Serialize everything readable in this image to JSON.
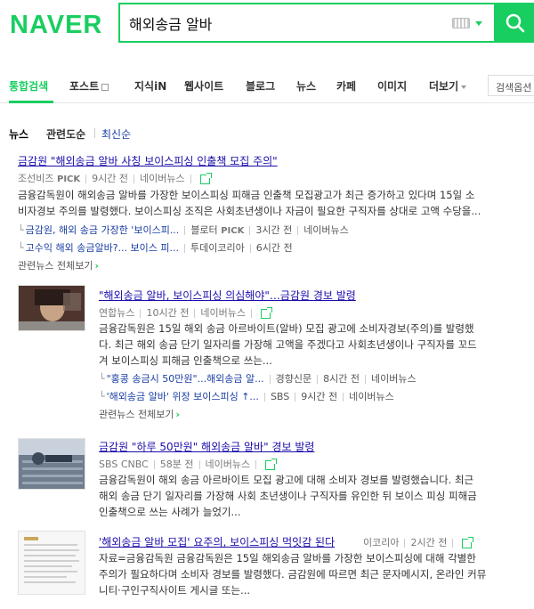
{
  "header": {
    "logo": "NAVER",
    "query": "해외송금 알바"
  },
  "tabs": {
    "items": [
      "통합검색",
      "포스트",
      "지식iN",
      "웹사이트",
      "블로그",
      "뉴스",
      "카페",
      "이미지",
      "더보기"
    ],
    "search_option": "검색옵션"
  },
  "sort": {
    "label": "뉴스",
    "options": [
      "관련도순",
      "최신순"
    ]
  },
  "articles": [
    {
      "title": "금감원 \"해외송금 알바 사칭 보이스피싱 인출책 모집 주의\"",
      "source": "조선비즈",
      "pick": "PICK",
      "time": "9시간 전",
      "naver": "네이버뉴스",
      "desc_line1": "금융감독원이 해외송금 알바를 가장한 보이스피싱 피해금 인출책 모집광고가 최근 증가하고 있다며 15일 소",
      "desc_line2": "비자경보 주의를 발령했다. 보이스피싱 조직은 사회초년생이나 자금이 필요한 구직자를 상대로 고액 수당을...",
      "subs": [
        {
          "text": "금감원, 해외 송금 가장한 '보이스피...",
          "source": "블로터",
          "pick": "PICK",
          "time": "3시간 전",
          "naver": "네이버뉴스"
        },
        {
          "text": "고수익 해외 송금알바?... 보이스 피...",
          "source": "투데이코리아",
          "time": "6시간 전"
        }
      ],
      "related": "관련뉴스 전체보기"
    },
    {
      "title": "\"해외송금 알바, 보이스피싱 의심해야\"…금감원 경보 발령",
      "source": "연합뉴스",
      "time": "10시간 전",
      "naver": "네이버뉴스",
      "desc_line1": "금융감독원은 15일 해외 송금 아르바이트(알바) 모집 광고에 소비자경보(주의)를 발령했",
      "desc_line2": "다. 최근 해외 송금 단기 일자리를 가장해 고액을 주겠다고 사회초년생이나 구직자를 꼬드",
      "desc_line3": "겨 보이스피싱 피해금 인출책으로 쓰는...",
      "subs": [
        {
          "text": "\"홍콩 송금시 50만원\"...해외송금 알...",
          "source": "경향신문",
          "time": "8시간 전",
          "naver": "네이버뉴스"
        },
        {
          "text": "'해외송금 알바' 위장 보이스피싱 ↑...",
          "source": "SBS",
          "time": "9시간 전",
          "naver": "네이버뉴스"
        }
      ],
      "related": "관련뉴스 전체보기"
    },
    {
      "title": "금감원 \"하루 50만원\" 해외송금 알바\" 경보 발령",
      "source": "SBS CNBC",
      "time": "58분 전",
      "naver": "네이버뉴스",
      "desc_line1": "금융감독원이 해외 송금 아르바이트 모집 광고에 대해 소비자 경보를 발령했습니다. 최근",
      "desc_line2": "해외 송금 단기 일자리를 가장해 사회 초년생이나 구직자를 유인한 뒤 보이스 피싱 피해금",
      "desc_line3": "인출책으로 쓰는 사례가 늘었기..."
    },
    {
      "title": "'해외송금 알바 모집' 요주의, 보이스피싱 먹잇감 된다",
      "source": "이코리아",
      "time": "2시간 전",
      "desc_line1": "자료=금융감독원 금융감독원은 15일 해외송금 알바를 가장한 보이스피싱에 대해 각별한",
      "desc_line2": "주의가 필요하다며 소비자 경보를 발령했다. 금감원에 따르면 최근 문자메시지, 온라인 커뮤",
      "desc_line3": "니티·구인구직사이트 게시글 또는..."
    }
  ],
  "colors": {
    "brand": "#19ce60",
    "link": "#1a0dab"
  }
}
